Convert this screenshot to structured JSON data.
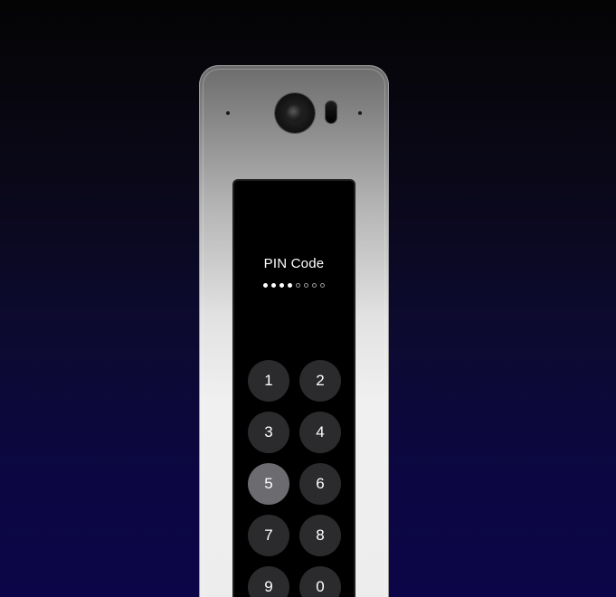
{
  "device": {
    "icons": [
      "camera-icon",
      "ir-sensor-icon"
    ]
  },
  "screen": {
    "title": "PIN Code",
    "pin_indicator": {
      "total": 8,
      "filled": 4
    },
    "keypad": {
      "keys": [
        "1",
        "2",
        "3",
        "4",
        "5",
        "6",
        "7",
        "8",
        "9",
        "0"
      ],
      "pressed_key": "5"
    }
  },
  "colors": {
    "background_top": "#040404",
    "background_bottom": "#0c0648",
    "screen": "#000000",
    "key": "#2b2b2d",
    "key_pressed": "#6b6b70",
    "text": "#ffffff"
  }
}
